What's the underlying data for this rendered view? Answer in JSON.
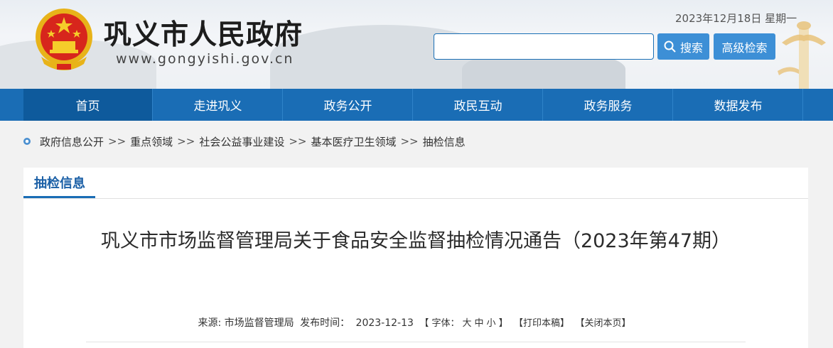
{
  "header": {
    "site_name": "巩义市人民政府",
    "site_domain": "www.gongyishi.gov.cn",
    "date": "2023年12月18日 星期一",
    "search_placeholder": "",
    "search_button": "搜索",
    "advanced_search_button": "高级检索"
  },
  "nav": {
    "items": [
      "首页",
      "走进巩义",
      "政务公开",
      "政民互动",
      "政务服务",
      "数据发布"
    ],
    "active": "首页"
  },
  "breadcrumb": {
    "items": [
      "政府信息公开",
      "重点领域",
      "社会公益事业建设",
      "基本医疗卫生领域",
      "抽检信息"
    ],
    "separator": ">>"
  },
  "article": {
    "section_tab": "抽检信息",
    "title": "巩义市市场监督管理局关于食品安全监督抽检情况通告（2023年第47期）",
    "source_label": "来源: 市场监督管理局",
    "publish_label": "发布时间：",
    "publish_date": "2023-12-13",
    "font_size_label": "【 字体：",
    "font_large": "大",
    "font_medium": "中",
    "font_small": "小",
    "font_close": "】",
    "print": "【打印本稿】",
    "close_page": "【关闭本页】"
  },
  "colors": {
    "nav_bg": "#1a6db5",
    "accent": "#3d8fd6",
    "tab_text": "#1a5fa6"
  }
}
